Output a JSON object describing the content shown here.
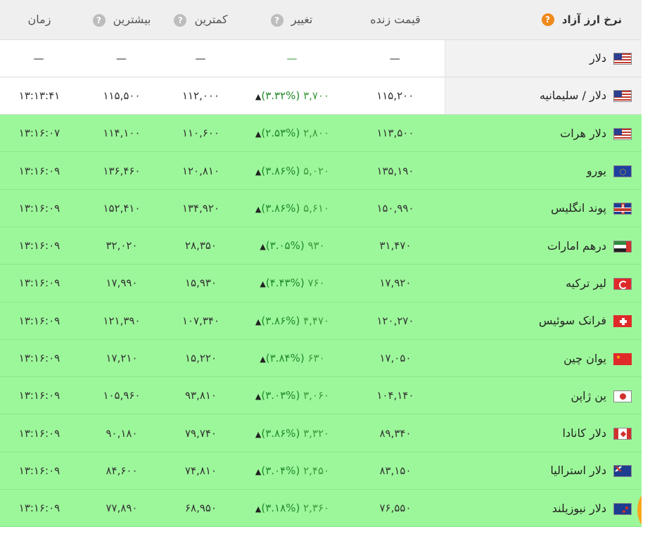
{
  "table": {
    "headers": {
      "name": "نرخ ارز آزاد",
      "price": "قیمت زنده",
      "change": "تغییر",
      "low": "کمترین",
      "high": "بیشترین",
      "time": "زمان"
    },
    "help_glyph": "?",
    "rows": [
      {
        "name": "دلار",
        "flag": "us-flag-icon",
        "price": "—",
        "change": "",
        "change_val": "—",
        "arrow": "",
        "low": "—",
        "high": "—",
        "time": "—",
        "highlight": false
      },
      {
        "name": "دلار / سلیمانیه",
        "flag": "us-flag-icon",
        "price": "۱۱۵,۲۰۰",
        "change": "(۳.۳۲%)",
        "change_val": "۳,۷۰۰",
        "arrow": "▲",
        "low": "۱۱۲,۰۰۰",
        "high": "۱۱۵,۵۰۰",
        "time": "۱۳:۱۳:۴۱",
        "highlight": false
      },
      {
        "name": "دلار هرات",
        "flag": "us-flag-icon",
        "price": "۱۱۳,۵۰۰",
        "change": "(۲.۵۳%)",
        "change_val": "۲,۸۰۰",
        "arrow": "▲",
        "low": "۱۱۰,۶۰۰",
        "high": "۱۱۴,۱۰۰",
        "time": "۱۳:۱۶:۰۷",
        "highlight": true
      },
      {
        "name": "یورو",
        "flag": "eu-flag-icon",
        "price": "۱۳۵,۱۹۰",
        "change": "(۳.۸۶%)",
        "change_val": "۵,۰۲۰",
        "arrow": "▲",
        "low": "۱۲۰,۸۱۰",
        "high": "۱۳۶,۴۶۰",
        "time": "۱۳:۱۶:۰۹",
        "highlight": true
      },
      {
        "name": "پوند انگلیس",
        "flag": "gb-flag-icon",
        "price": "۱۵۰,۹۹۰",
        "change": "(۳.۸۶%)",
        "change_val": "۵,۶۱۰",
        "arrow": "▲",
        "low": "۱۳۴,۹۲۰",
        "high": "۱۵۲,۴۱۰",
        "time": "۱۳:۱۶:۰۹",
        "highlight": true
      },
      {
        "name": "درهم امارات",
        "flag": "ae-flag-icon",
        "price": "۳۱,۴۷۰",
        "change": "(۳.۰۵%)",
        "change_val": "۹۳۰",
        "arrow": "▲",
        "low": "۲۸,۳۵۰",
        "high": "۳۲,۰۲۰",
        "time": "۱۳:۱۶:۰۹",
        "highlight": true
      },
      {
        "name": "لیر ترکیه",
        "flag": "tr-flag-icon",
        "price": "۱۷,۹۲۰",
        "change": "(۴.۴۳%)",
        "change_val": "۷۶۰",
        "arrow": "▲",
        "low": "۱۵,۹۳۰",
        "high": "۱۷,۹۹۰",
        "time": "۱۳:۱۶:۰۹",
        "highlight": true
      },
      {
        "name": "فرانک سوئیس",
        "flag": "ch-flag-icon",
        "price": "۱۲۰,۲۷۰",
        "change": "(۳.۸۶%)",
        "change_val": "۴,۴۷۰",
        "arrow": "▲",
        "low": "۱۰۷,۳۴۰",
        "high": "۱۲۱,۳۹۰",
        "time": "۱۳:۱۶:۰۹",
        "highlight": true
      },
      {
        "name": "یوان چین",
        "flag": "cn-flag-icon",
        "price": "۱۷,۰۵۰",
        "change": "(۳.۸۴%)",
        "change_val": "۶۳۰",
        "arrow": "▲",
        "low": "۱۵,۲۲۰",
        "high": "۱۷,۲۱۰",
        "time": "۱۳:۱۶:۰۹",
        "highlight": true
      },
      {
        "name": "ین ژاپن",
        "flag": "jp-flag-icon",
        "price": "۱۰۴,۱۴۰",
        "change": "(۳.۰۳%)",
        "change_val": "۳,۰۶۰",
        "arrow": "▲",
        "low": "۹۳,۸۱۰",
        "high": "۱۰۵,۹۶۰",
        "time": "۱۳:۱۶:۰۹",
        "highlight": true
      },
      {
        "name": "دلار کانادا",
        "flag": "ca-flag-icon",
        "price": "۸۹,۳۴۰",
        "change": "(۳.۸۶%)",
        "change_val": "۳,۳۲۰",
        "arrow": "▲",
        "low": "۷۹,۷۴۰",
        "high": "۹۰,۱۸۰",
        "time": "۱۳:۱۶:۰۹",
        "highlight": true
      },
      {
        "name": "دلار استرالیا",
        "flag": "au-flag-icon",
        "price": "۸۳,۱۵۰",
        "change": "(۳.۰۴%)",
        "change_val": "۲,۴۵۰",
        "arrow": "▲",
        "low": "۷۴,۸۱۰",
        "high": "۸۴,۶۰۰",
        "time": "۱۳:۱۶:۰۹",
        "highlight": true
      },
      {
        "name": "دلار نیوزیلند",
        "flag": "nz-flag-icon",
        "price": "۷۶,۵۵۰",
        "change": "(۳.۱۸%)",
        "change_val": "۲,۳۶۰",
        "arrow": "▲",
        "low": "۶۸,۹۵۰",
        "high": "۷۷,۸۹۰",
        "time": "۱۳:۱۶:۰۹",
        "highlight": true
      }
    ]
  },
  "colors": {
    "highlight_row": "#9cf79a",
    "help_badge_orange": "#f08a1c",
    "help_badge_gray": "#bdbdbd",
    "change_text": "#3a9c3a"
  }
}
